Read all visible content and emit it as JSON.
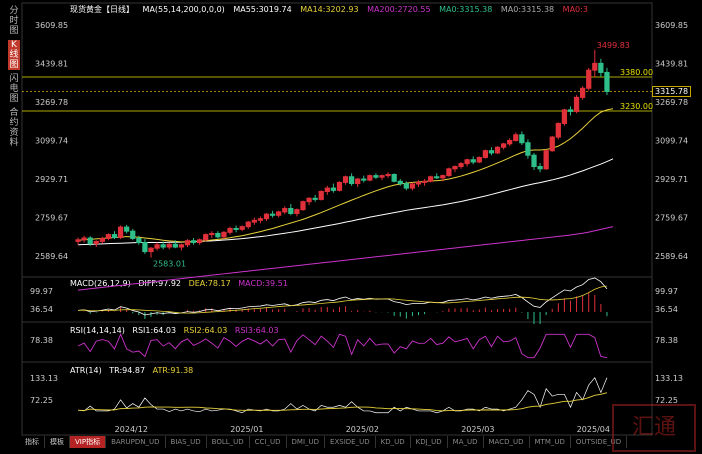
{
  "side_tabs": [
    "分时图",
    "K线图",
    "闪电图",
    "合约资料"
  ],
  "header": {
    "title": "现货黄金【日线】",
    "ma_label": "MA(55,14,200,0,0,0)",
    "ma55": "MA55:3019.74",
    "ma14": "MA14:3202.93",
    "ma200": "MA200:2720.55",
    "ma0a": "MA0:3315.38",
    "ma0b": "MA0:3315.38",
    "ma0c": "MA0:3"
  },
  "macd_header": {
    "label": "MACD(26,12,9)",
    "diff": "DIFF:97.92",
    "dea": "DEA:78.17",
    "macd": "MACD:39.51"
  },
  "rsi_header": {
    "label": "RSI(14,14,14)",
    "rsi1": "RSI1:64.03",
    "rsi2": "RSI2:64.03",
    "rsi3": "RSI3:64.03"
  },
  "atr_header": {
    "label": "ATR(14)",
    "tr": "TR:94.87",
    "atr": "ATR:91.38"
  },
  "price_axis_ticks": [
    "3609.85",
    "3439.81",
    "3269.78",
    "3099.74",
    "2929.71",
    "2759.67",
    "2589.64"
  ],
  "macd_ticks": [
    "99.97",
    "36.54"
  ],
  "rsi_ticks": [
    "78.38"
  ],
  "atr_ticks": [
    "133.13",
    "72.25"
  ],
  "current_price": "3315.78",
  "x_labels": [
    "2024/12",
    "2025/01",
    "2025/02",
    "2025/03",
    "2025/04"
  ],
  "bottom_buttons": [
    "指标",
    "模板",
    "VIP指标",
    "BARUPDN_UD",
    "BIAS_UD",
    "BOLL_UD",
    "CCI_UD",
    "DMI_UD",
    "EXSIDE_UD",
    "KD_UD",
    "KDJ_UD",
    "MA_UD",
    "MACD_UD",
    "MTM_UD",
    "OUTSIDE_UD"
  ],
  "colors": {
    "up": "#e0303a",
    "down": "#2fbf8a",
    "ma55": "#ffffff",
    "ma14": "#e8d23a",
    "ma200": "#cc33cc",
    "level": "#e8e000"
  },
  "chart_data": {
    "type": "candlestick",
    "title": "现货黄金【日线】",
    "ylim": [
      2520,
      3640
    ],
    "annotations": {
      "high": "3499.83",
      "low": "2583.01",
      "level1": "3380.00",
      "level2": "3230.00"
    },
    "levels": [
      3380.0,
      3230.0
    ],
    "ohlc": [
      [
        2655,
        2672,
        2640,
        2662
      ],
      [
        2662,
        2680,
        2650,
        2670
      ],
      [
        2670,
        2678,
        2635,
        2645
      ],
      [
        2645,
        2660,
        2630,
        2655
      ],
      [
        2655,
        2675,
        2645,
        2668
      ],
      [
        2668,
        2690,
        2660,
        2685
      ],
      [
        2685,
        2700,
        2665,
        2672
      ],
      [
        2672,
        2725,
        2665,
        2718
      ],
      [
        2718,
        2728,
        2690,
        2700
      ],
      [
        2700,
        2710,
        2660,
        2668
      ],
      [
        2668,
        2680,
        2640,
        2650
      ],
      [
        2650,
        2665,
        2600,
        2610
      ],
      [
        2610,
        2630,
        2583,
        2625
      ],
      [
        2625,
        2650,
        2615,
        2640
      ],
      [
        2640,
        2655,
        2620,
        2630
      ],
      [
        2630,
        2648,
        2620,
        2642
      ],
      [
        2642,
        2660,
        2625,
        2630
      ],
      [
        2630,
        2645,
        2615,
        2640
      ],
      [
        2640,
        2665,
        2630,
        2658
      ],
      [
        2658,
        2670,
        2640,
        2650
      ],
      [
        2650,
        2668,
        2640,
        2662
      ],
      [
        2662,
        2690,
        2655,
        2685
      ],
      [
        2685,
        2700,
        2670,
        2690
      ],
      [
        2690,
        2700,
        2668,
        2675
      ],
      [
        2675,
        2700,
        2665,
        2695
      ],
      [
        2695,
        2720,
        2685,
        2712
      ],
      [
        2712,
        2725,
        2695,
        2708
      ],
      [
        2708,
        2725,
        2700,
        2720
      ],
      [
        2720,
        2745,
        2710,
        2740
      ],
      [
        2740,
        2760,
        2728,
        2748
      ],
      [
        2748,
        2765,
        2735,
        2755
      ],
      [
        2755,
        2780,
        2745,
        2775
      ],
      [
        2775,
        2790,
        2760,
        2770
      ],
      [
        2770,
        2790,
        2760,
        2785
      ],
      [
        2785,
        2810,
        2775,
        2800
      ],
      [
        2800,
        2820,
        2770,
        2778
      ],
      [
        2778,
        2800,
        2765,
        2795
      ],
      [
        2795,
        2835,
        2790,
        2830
      ],
      [
        2830,
        2850,
        2815,
        2845
      ],
      [
        2845,
        2860,
        2830,
        2840
      ],
      [
        2840,
        2880,
        2835,
        2875
      ],
      [
        2875,
        2900,
        2860,
        2890
      ],
      [
        2890,
        2910,
        2870,
        2880
      ],
      [
        2880,
        2920,
        2875,
        2915
      ],
      [
        2915,
        2945,
        2905,
        2940
      ],
      [
        2940,
        2955,
        2900,
        2910
      ],
      [
        2910,
        2935,
        2895,
        2930
      ],
      [
        2930,
        2945,
        2915,
        2925
      ],
      [
        2925,
        2950,
        2920,
        2945
      ],
      [
        2945,
        2955,
        2930,
        2938
      ],
      [
        2938,
        2950,
        2925,
        2945
      ],
      [
        2945,
        2960,
        2935,
        2950
      ],
      [
        2950,
        2955,
        2915,
        2920
      ],
      [
        2920,
        2930,
        2900,
        2910
      ],
      [
        2910,
        2920,
        2880,
        2890
      ],
      [
        2890,
        2915,
        2880,
        2908
      ],
      [
        2908,
        2925,
        2895,
        2915
      ],
      [
        2915,
        2930,
        2900,
        2920
      ],
      [
        2920,
        2945,
        2915,
        2940
      ],
      [
        2940,
        2955,
        2930,
        2935
      ],
      [
        2935,
        2950,
        2920,
        2945
      ],
      [
        2945,
        2980,
        2940,
        2975
      ],
      [
        2975,
        2990,
        2960,
        2985
      ],
      [
        2985,
        3005,
        2975,
        2998
      ],
      [
        2998,
        3020,
        2985,
        3015
      ],
      [
        3015,
        3030,
        2995,
        3005
      ],
      [
        3005,
        3030,
        3000,
        3025
      ],
      [
        3025,
        3060,
        3020,
        3055
      ],
      [
        3055,
        3070,
        3035,
        3045
      ],
      [
        3045,
        3075,
        3040,
        3070
      ],
      [
        3070,
        3090,
        3060,
        3085
      ],
      [
        3085,
        3110,
        3075,
        3100
      ],
      [
        3100,
        3135,
        3095,
        3125
      ],
      [
        3125,
        3140,
        3080,
        3090
      ],
      [
        3090,
        3105,
        3020,
        3035
      ],
      [
        3035,
        3045,
        2970,
        2985
      ],
      [
        2985,
        3000,
        2960,
        2975
      ],
      [
        2975,
        3060,
        2970,
        3055
      ],
      [
        3055,
        3120,
        3050,
        3115
      ],
      [
        3115,
        3180,
        3105,
        3175
      ],
      [
        3175,
        3240,
        3165,
        3235
      ],
      [
        3235,
        3250,
        3210,
        3228
      ],
      [
        3228,
        3300,
        3220,
        3290
      ],
      [
        3290,
        3340,
        3280,
        3330
      ],
      [
        3330,
        3420,
        3320,
        3410
      ],
      [
        3410,
        3500,
        3380,
        3440
      ],
      [
        3440,
        3460,
        3380,
        3400
      ],
      [
        3400,
        3420,
        3300,
        3316
      ]
    ],
    "ma14": [
      2660,
      2662,
      2664,
      2666,
      2668,
      2670,
      2672,
      2674,
      2676,
      2675,
      2673,
      2670,
      2667,
      2664,
      2660,
      2657,
      2655,
      2653,
      2653,
      2654,
      2656,
      2658,
      2661,
      2664,
      2667,
      2671,
      2676,
      2680,
      2686,
      2692,
      2698,
      2705,
      2712,
      2720,
      2728,
      2736,
      2744,
      2752,
      2762,
      2772,
      2782,
      2793,
      2804,
      2815,
      2826,
      2837,
      2847,
      2858,
      2868,
      2878,
      2887,
      2896,
      2903,
      2908,
      2912,
      2915,
      2917,
      2919,
      2921,
      2923,
      2925,
      2930,
      2936,
      2943,
      2951,
      2960,
      2969,
      2979,
      2990,
      3001,
      3012,
      3024,
      3036,
      3047,
      3055,
      3058,
      3058,
      3060,
      3066,
      3075,
      3090,
      3108,
      3130,
      3154,
      3180,
      3205,
      3225,
      3235,
      3240
    ],
    "ma55": [
      2640,
      2641,
      2642,
      2643,
      2644,
      2645,
      2646,
      2647,
      2648,
      2649,
      2650,
      2650,
      2650,
      2650,
      2650,
      2651,
      2651,
      2652,
      2653,
      2654,
      2655,
      2656,
      2657,
      2659,
      2661,
      2663,
      2665,
      2667,
      2670,
      2673,
      2676,
      2679,
      2683,
      2687,
      2691,
      2695,
      2699,
      2704,
      2709,
      2714,
      2719,
      2724,
      2729,
      2734,
      2740,
      2745,
      2751,
      2756,
      2762,
      2767,
      2772,
      2777,
      2782,
      2787,
      2792,
      2796,
      2800,
      2804,
      2808,
      2812,
      2816,
      2821,
      2826,
      2831,
      2837,
      2843,
      2849,
      2855,
      2862,
      2869,
      2876,
      2883,
      2890,
      2897,
      2903,
      2909,
      2914,
      2920,
      2926,
      2933,
      2940,
      2948,
      2957,
      2966,
      2976,
      2986,
      2996,
      3007,
      3019
    ],
    "ma200": [
      2440,
      2443,
      2446,
      2449,
      2452,
      2455,
      2458,
      2461,
      2464,
      2467,
      2470,
      2473,
      2476,
      2479,
      2482,
      2485,
      2488,
      2491,
      2494,
      2497,
      2500,
      2503,
      2506,
      2509,
      2512,
      2515,
      2518,
      2521,
      2524,
      2527,
      2530,
      2533,
      2536,
      2539,
      2542,
      2545,
      2548,
      2551,
      2554,
      2557,
      2560,
      2563,
      2566,
      2569,
      2572,
      2575,
      2578,
      2581,
      2584,
      2587,
      2590,
      2593,
      2596,
      2599,
      2602,
      2605,
      2608,
      2611,
      2614,
      2617,
      2620,
      2623,
      2626,
      2629,
      2632,
      2635,
      2638,
      2641,
      2644,
      2647,
      2650,
      2653,
      2656,
      2659,
      2662,
      2665,
      2668,
      2671,
      2674,
      2677,
      2680,
      2683,
      2687,
      2691,
      2696,
      2702,
      2708,
      2714,
      2720
    ]
  }
}
